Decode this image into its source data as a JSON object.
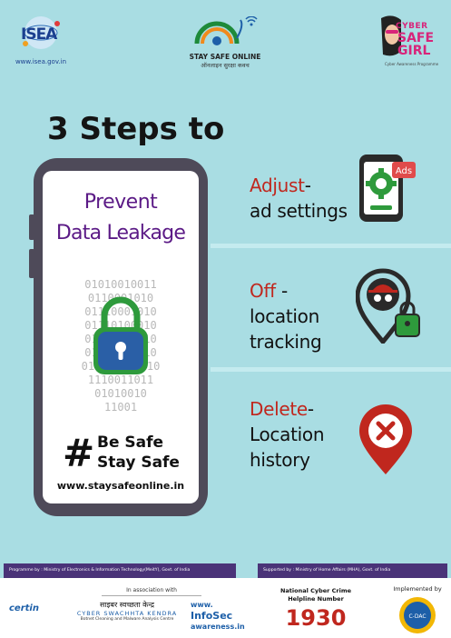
{
  "logos": {
    "isea_word": "ISEA",
    "isea_url": "www.isea.gov.in",
    "sso_title": "STAY SAFE ONLINE",
    "sso_subtitle": "ऑनलाइन सुरक्षा कवच",
    "csg_cyber": "CYBER",
    "csg_safe": "SAFE",
    "csg_girl": "GIRL",
    "csg_sub": "Cyber Awareness Programme"
  },
  "title": "3 Steps to",
  "phone": {
    "line1": "Prevent",
    "line2": "Data Leakage",
    "binary": "01010010011\n0110001010\n01110001010\n01110100010\n0110 011010\n01011101010\n011100101010\n1110011011\n01010010\n11001",
    "hashtag": "#",
    "tagline1": "Be Safe",
    "tagline2": "Stay Safe",
    "url": "www.staysafeonline.in"
  },
  "steps": [
    {
      "highlight": "Adjust",
      "rest": "-",
      "line2": "ad settings",
      "icon": "phone-settings-ads-icon",
      "badge": "Ads"
    },
    {
      "highlight": "Off",
      "rest": " -",
      "line2": "location",
      "line3": "tracking",
      "icon": "location-spy-lock-icon"
    },
    {
      "highlight": "Delete",
      "rest": "-",
      "line2": "Location",
      "line3": "history",
      "icon": "location-delete-icon"
    }
  ],
  "footer": {
    "bar_left": "Programme by : Ministry of Electronics & Information Technology(MeitY), Govt. of India",
    "bar_right": "Supported by : Ministry of Home Affairs (MHA), Govt. of India",
    "assoc": "In association with",
    "cert": "certin",
    "csk_hindi": "साइबर स्वच्छता केन्द्र",
    "csk_name": "CYBER SWACHHTA KENDRA",
    "csk_sub": "Botnet Cleaning and Malware Analysis Centre",
    "infosec1": "www.",
    "infosec2": "InfoSec",
    "infosec3": "awareness.in",
    "helpline1": "National Cyber Crime",
    "helpline2": "Helpline Number",
    "helpline_number": "1930",
    "implemented": "Implemented by",
    "cdac": "C-DAC"
  },
  "colors": {
    "background": "#a9dde3",
    "accent_red": "#c0271e",
    "purple": "#5b1a86",
    "phone_body": "#4e4a59",
    "green": "#2e9a3c",
    "lock_blue": "#2a5fa6"
  }
}
